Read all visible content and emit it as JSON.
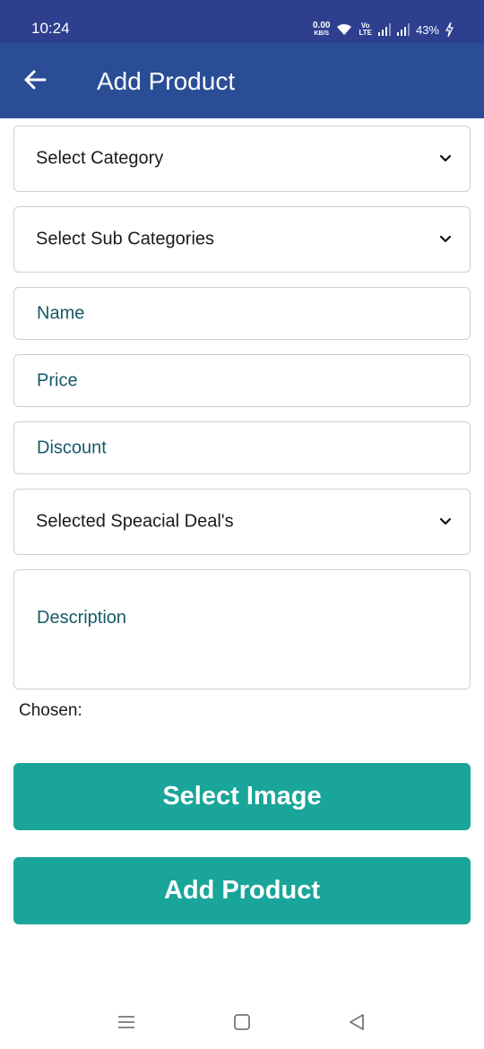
{
  "status_bar": {
    "time": "10:24",
    "speed_value": "0.00",
    "speed_unit": "KB/S",
    "volte_top": "Vo",
    "volte_bottom": "LTE",
    "battery": "43%"
  },
  "app_bar": {
    "title": "Add Product",
    "background_color": "#2a4d96"
  },
  "form": {
    "category_select": "Select Category",
    "subcategory_select": "Select Sub Categories",
    "name_placeholder": "Name",
    "price_placeholder": "Price",
    "discount_placeholder": "Discount",
    "special_deal_select": "Selected Speacial Deal's",
    "description_placeholder": "Description",
    "chosen_label": "Chosen:"
  },
  "buttons": {
    "select_image": "Select Image",
    "add_product": "Add Product",
    "color": "#19a59a"
  },
  "nav_bar": {
    "icons": [
      "menu-icon",
      "home-square-icon",
      "back-triangle-icon"
    ]
  }
}
